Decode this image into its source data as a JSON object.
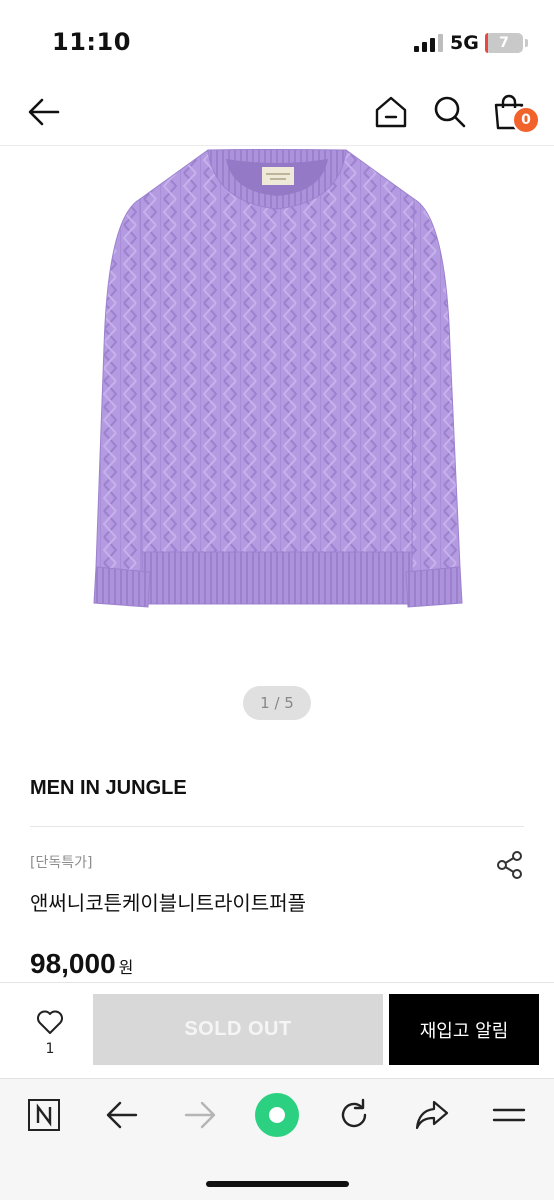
{
  "status_bar": {
    "time": "11:10",
    "network": "5G",
    "battery_level": "7",
    "battery_fraction": 0.07,
    "battery_color": "#e9473f"
  },
  "top_nav": {
    "back_icon": "arrow-left-icon",
    "home_icon": "home-icon",
    "search_icon": "search-icon",
    "cart_icon": "shopping-bag-icon",
    "cart_count": "0",
    "badge_color": "#f2622b"
  },
  "gallery": {
    "counter": "1 / 5",
    "image_color": "#b49ae0"
  },
  "product": {
    "brand": "MEN IN JUNGLE",
    "tag": "[단독특가]",
    "name": "앤써니코튼케이블니트라이트퍼플",
    "price": "98,000",
    "currency": "원",
    "share_icon": "share-icon"
  },
  "purchase_bar": {
    "like_icon": "heart-icon",
    "like_count": "1",
    "soldout_label": "SOLD OUT",
    "restock_label": "재입고 알림"
  },
  "browser_bar": {
    "icons": [
      "naver-icon",
      "arrow-back-icon",
      "arrow-forward-icon",
      "green-dot-icon",
      "refresh-icon",
      "share-arrow-icon",
      "menu-icon"
    ],
    "accent": "#2bd180"
  }
}
